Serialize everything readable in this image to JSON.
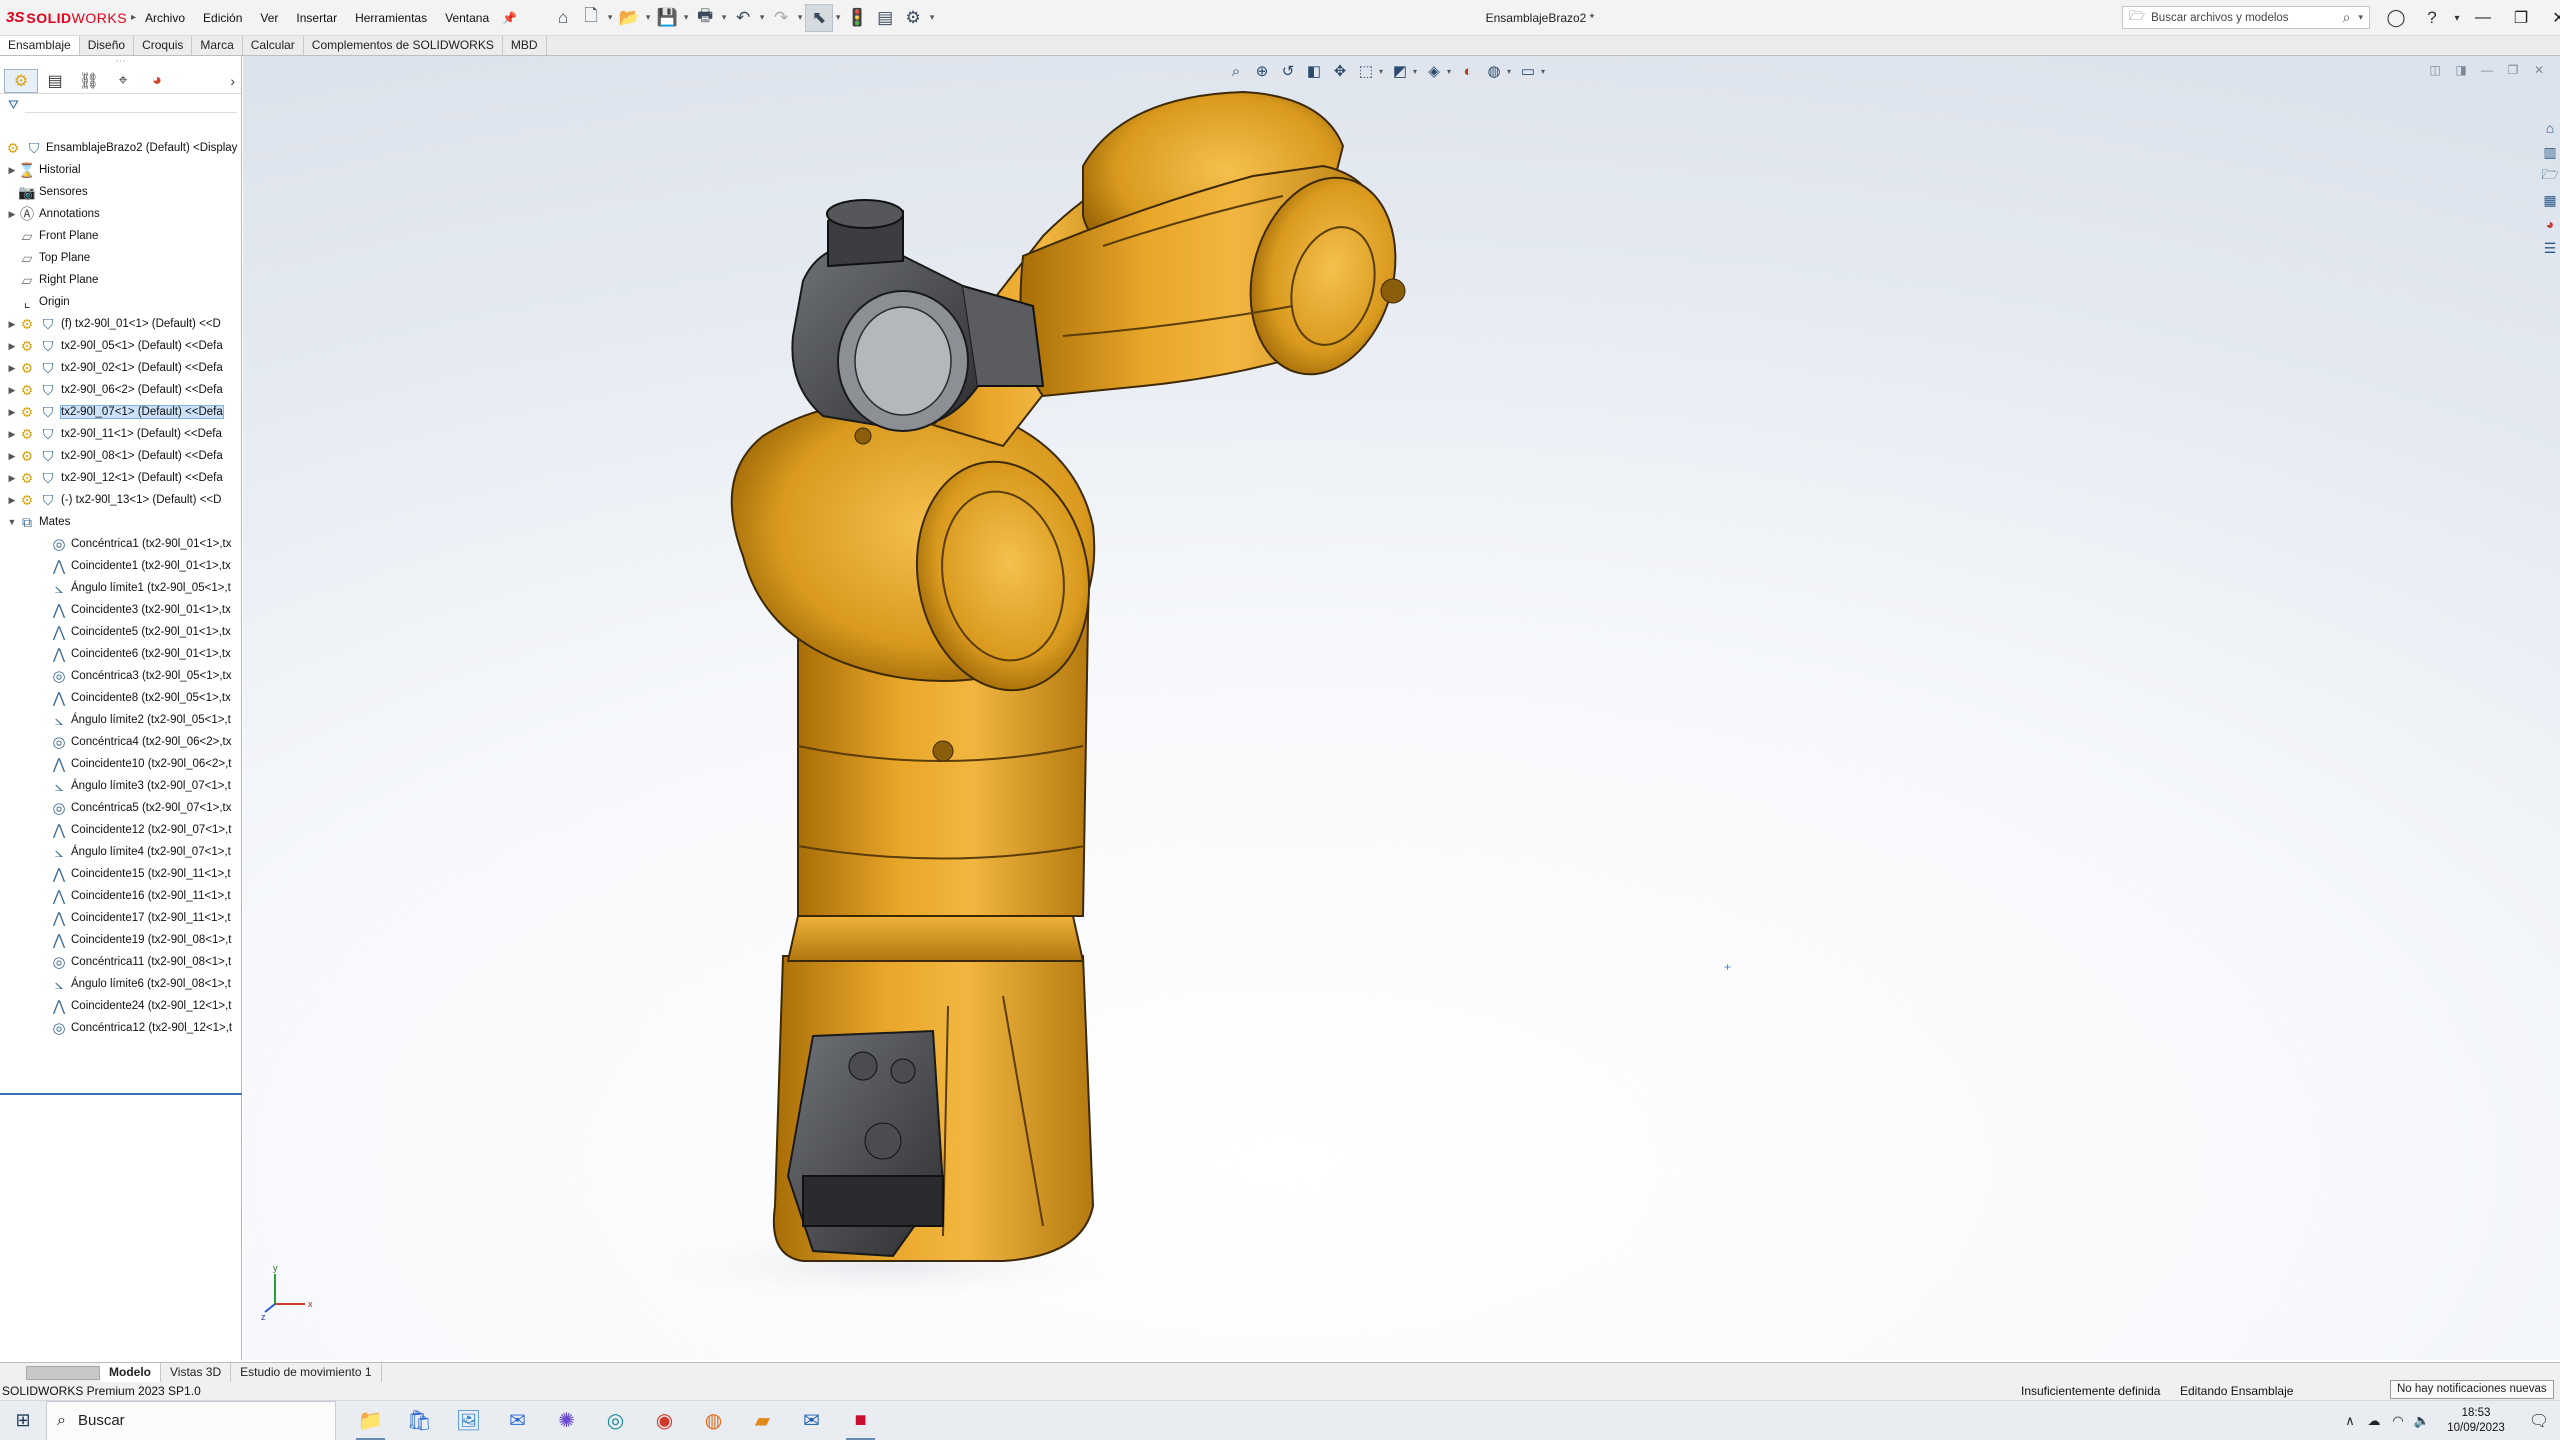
{
  "app": {
    "logo_ds": "3S",
    "logo_solid": "SOLID",
    "logo_works": "WORKS",
    "document_title": "EnsamblajeBrazo2 *"
  },
  "menu": [
    {
      "label": "Archivo"
    },
    {
      "label": "Edición"
    },
    {
      "label": "Ver"
    },
    {
      "label": "Insertar"
    },
    {
      "label": "Herramientas"
    },
    {
      "label": "Ventana"
    }
  ],
  "search": {
    "placeholder": "Buscar archivos y modelos"
  },
  "command_tabs": [
    {
      "label": "Ensamblaje"
    },
    {
      "label": "Diseño"
    },
    {
      "label": "Croquis"
    },
    {
      "label": "Marca"
    },
    {
      "label": "Calcular"
    },
    {
      "label": "Complementos de SOLIDWORKS"
    },
    {
      "label": "MBD"
    }
  ],
  "tree": {
    "root": "EnsamblajeBrazo2 (Default) <Display",
    "folders": [
      {
        "label": "Historial",
        "icon": "history-icon"
      },
      {
        "label": "Sensores",
        "icon": "sensor-icon"
      },
      {
        "label": "Annotations",
        "icon": "annotation-icon"
      },
      {
        "label": "Front Plane",
        "icon": "plane-icon"
      },
      {
        "label": "Top Plane",
        "icon": "plane-icon"
      },
      {
        "label": "Right Plane",
        "icon": "plane-icon"
      },
      {
        "label": "Origin",
        "icon": "origin-icon"
      }
    ],
    "components": [
      {
        "label": "(f) tx2-90l_01<1> (Default) <<D"
      },
      {
        "label": "tx2-90l_05<1> (Default) <<Defa"
      },
      {
        "label": "tx2-90l_02<1> (Default) <<Defa"
      },
      {
        "label": "tx2-90l_06<2> (Default) <<Defa"
      },
      {
        "label": "tx2-90l_07<1> (Default) <<Defa"
      },
      {
        "label": "tx2-90l_11<1> (Default) <<Defa"
      },
      {
        "label": "tx2-90l_08<1> (Default) <<Defa"
      },
      {
        "label": "tx2-90l_12<1> (Default) <<Defa"
      },
      {
        "label": "(-) tx2-90l_13<1> (Default) <<D"
      }
    ],
    "mates_label": "Mates",
    "mates": [
      {
        "label": "Concéntrica1 (tx2-90l_01<1>,tx",
        "type": "concentric"
      },
      {
        "label": "Coincidente1 (tx2-90l_01<1>,tx",
        "type": "coincident"
      },
      {
        "label": "Ángulo límite1 (tx2-90l_05<1>,t",
        "type": "angle"
      },
      {
        "label": "Coincidente3 (tx2-90l_01<1>,tx",
        "type": "coincident"
      },
      {
        "label": "Coincidente5 (tx2-90l_01<1>,tx",
        "type": "coincident"
      },
      {
        "label": "Coincidente6 (tx2-90l_01<1>,tx",
        "type": "coincident"
      },
      {
        "label": "Concéntrica3 (tx2-90l_05<1>,tx",
        "type": "concentric"
      },
      {
        "label": "Coincidente8 (tx2-90l_05<1>,tx",
        "type": "coincident"
      },
      {
        "label": "Ángulo límite2 (tx2-90l_05<1>,t",
        "type": "angle"
      },
      {
        "label": "Concéntrica4 (tx2-90l_06<2>,tx",
        "type": "concentric"
      },
      {
        "label": "Coincidente10 (tx2-90l_06<2>,t",
        "type": "coincident"
      },
      {
        "label": "Ángulo límite3 (tx2-90l_07<1>,t",
        "type": "angle"
      },
      {
        "label": "Concéntrica5 (tx2-90l_07<1>,tx",
        "type": "concentric"
      },
      {
        "label": "Coincidente12 (tx2-90l_07<1>,t",
        "type": "coincident"
      },
      {
        "label": "Ángulo límite4 (tx2-90l_07<1>,t",
        "type": "angle"
      },
      {
        "label": "Coincidente15 (tx2-90l_11<1>,t",
        "type": "coincident"
      },
      {
        "label": "Coincidente16 (tx2-90l_11<1>,t",
        "type": "coincident"
      },
      {
        "label": "Coincidente17 (tx2-90l_11<1>,t",
        "type": "coincident"
      },
      {
        "label": "Coincidente19 (tx2-90l_08<1>,t",
        "type": "coincident"
      },
      {
        "label": "Concéntrica11 (tx2-90l_08<1>,t",
        "type": "concentric"
      },
      {
        "label": "Ángulo límite6 (tx2-90l_08<1>,t",
        "type": "angle"
      },
      {
        "label": "Coincidente24 (tx2-90l_12<1>,t",
        "type": "coincident"
      },
      {
        "label": "Concéntrica12 (tx2-90l_12<1>,t",
        "type": "concentric"
      }
    ]
  },
  "bottom_tabs": [
    {
      "label": "Modelo"
    },
    {
      "label": "Vistas 3D"
    },
    {
      "label": "Estudio de movimiento 1"
    }
  ],
  "status": {
    "product": "SOLIDWORKS Premium 2023 SP1.0",
    "definition": "Insuficientemente definida",
    "mode": "Editando Ensamblaje",
    "notification": "No hay notificaciones nuevas"
  },
  "taskbar": {
    "search_placeholder": "Buscar",
    "time": "18:53",
    "date": "10/09/2023"
  },
  "triad": {
    "x": "x",
    "y": "y",
    "z": "z"
  },
  "colors": {
    "robot_orange": "#e3a220",
    "robot_shadow": "#9c6a0c",
    "gripper_dark": "#3c3d40",
    "accent_red": "#e2001a"
  }
}
